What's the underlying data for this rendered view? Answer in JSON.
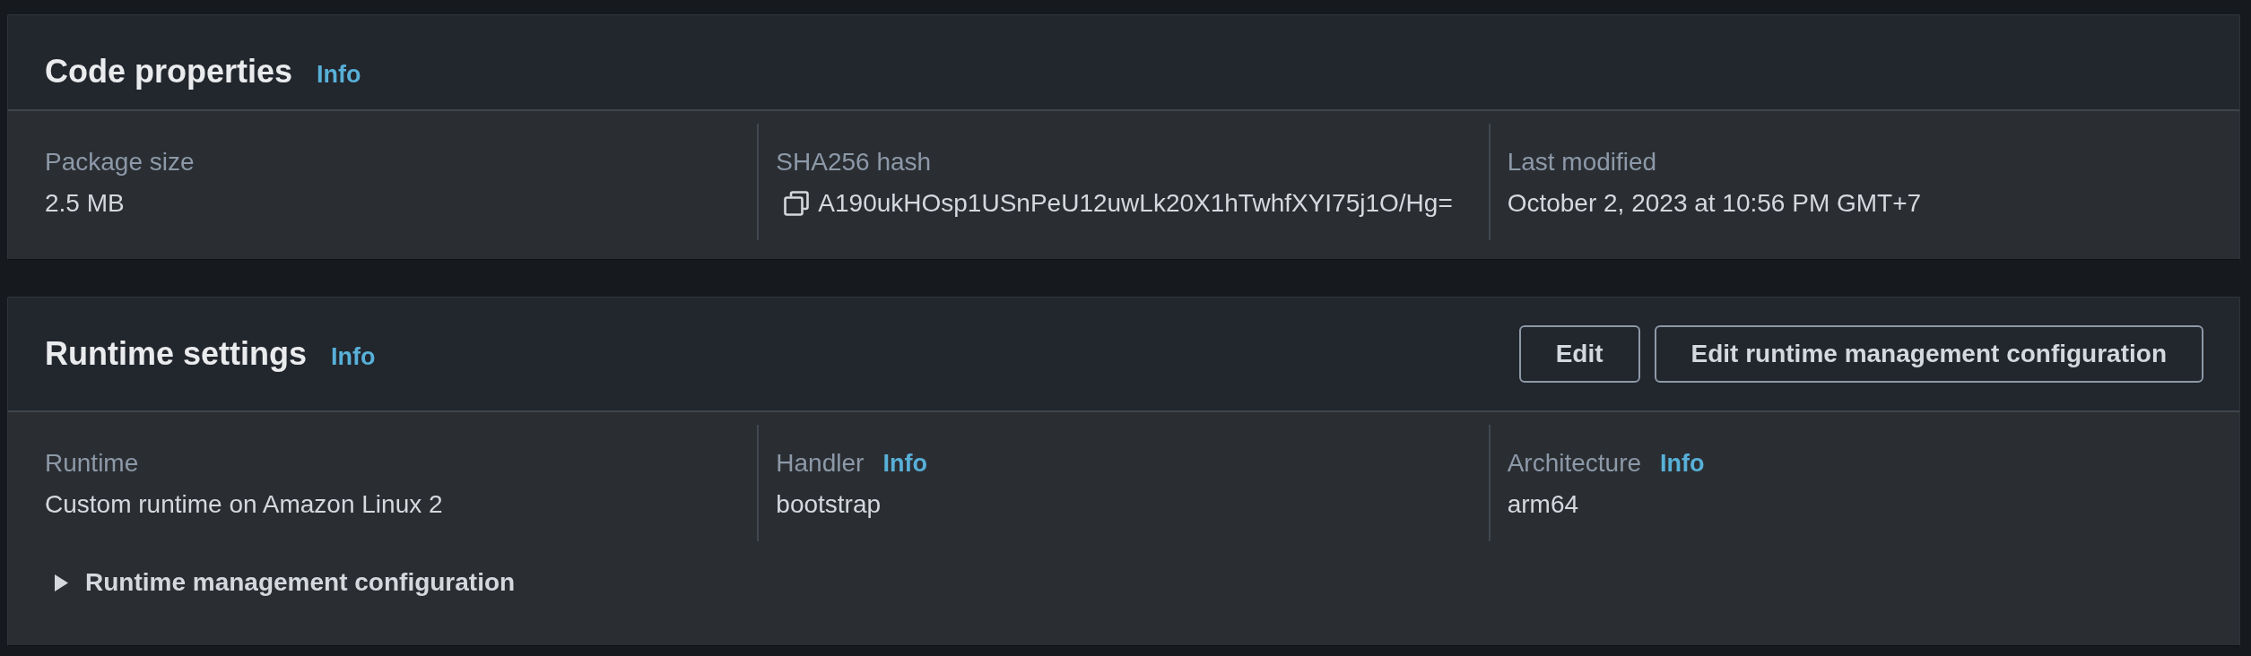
{
  "panels": [
    {
      "title": "Code properties",
      "info": "Info",
      "fields": [
        {
          "label": "Package size",
          "value": "2.5 MB",
          "copyable": false
        },
        {
          "label": "SHA256 hash",
          "value": "A190ukHOsp1USnPeU12uwLk20X1hTwhfXYI75j1O/Hg=",
          "copyable": true
        },
        {
          "label": "Last modified",
          "value": "October 2, 2023 at 10:56 PM GMT+7",
          "copyable": false
        }
      ]
    },
    {
      "title": "Runtime settings",
      "info": "Info",
      "actions": [
        "Edit",
        "Edit runtime management configuration"
      ],
      "fields": [
        {
          "label": "Runtime",
          "value": "Custom runtime on Amazon Linux 2",
          "copyable": false
        },
        {
          "label": "Handler",
          "info": "Info",
          "value": "bootstrap",
          "copyable": false
        },
        {
          "label": "Architecture",
          "info": "Info",
          "value": "arm64",
          "copyable": false
        }
      ],
      "expander": {
        "label": "Runtime management configuration",
        "expanded": false
      }
    }
  ]
}
